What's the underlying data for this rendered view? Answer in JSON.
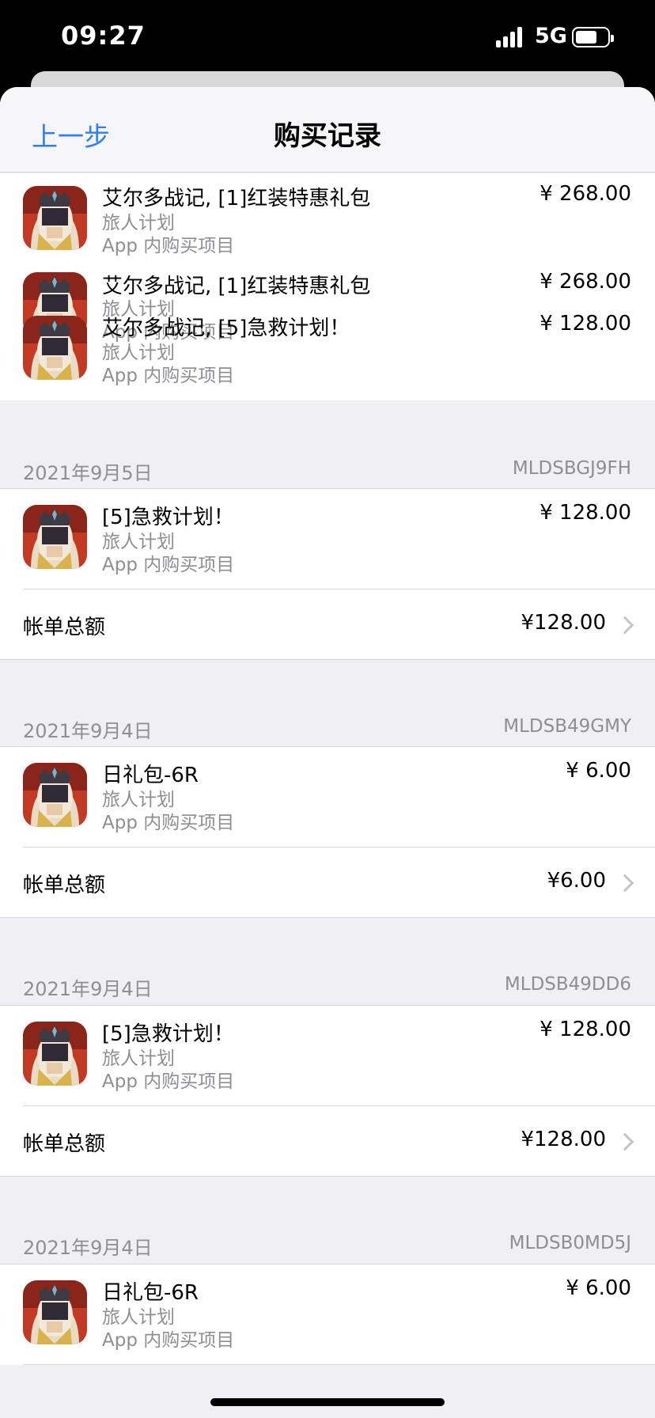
{
  "status_bar": {
    "time": "09:27",
    "network": "5G"
  },
  "nav": {
    "back_label": "上一步",
    "title": "购买记录"
  },
  "groups": [
    {
      "items": [
        {
          "name": "艾尔多战记, [1]红装特惠礼包",
          "developer": "旅人计划",
          "type": "App 内购买项目",
          "price": "¥ 268.00"
        },
        {
          "name": "艾尔多战记, [5]急救计划！",
          "developer": "旅人计划",
          "type": "App 内购买项目",
          "price": "¥ 128.00"
        }
      ]
    },
    {
      "date": "2021年9月5日",
      "order_id": "MLDSBGJ9FH",
      "items": [
        {
          "name": "[5]急救计划！",
          "developer": "旅人计划",
          "type": "App 内购买项目",
          "price": "¥ 128.00"
        }
      ],
      "total_label": "帐单总额",
      "total": "¥128.00"
    },
    {
      "date": "2021年9月4日",
      "order_id": "MLDSB49GMY",
      "items": [
        {
          "name": "日礼包-6R",
          "developer": "旅人计划",
          "type": "App 内购买项目",
          "price": "¥ 6.00"
        }
      ],
      "total_label": "帐单总额",
      "total": "¥6.00"
    },
    {
      "date": "2021年9月4日",
      "order_id": "MLDSB49DD6",
      "items": [
        {
          "name": "[5]急救计划！",
          "developer": "旅人计划",
          "type": "App 内购买项目",
          "price": "¥ 128.00"
        }
      ],
      "total_label": "帐单总额",
      "total": "¥128.00"
    },
    {
      "date": "2021年9月4日",
      "order_id": "MLDSB0MD5J",
      "items": [
        {
          "name": "日礼包-6R",
          "developer": "旅人计划",
          "type": "App 内购买项目",
          "price": "¥ 6.00"
        }
      ]
    }
  ],
  "icon": "game-app-icon",
  "colors": {
    "link": "#2f7ff0",
    "secondary_text": "#8e8e93",
    "background": "#efeff4"
  }
}
